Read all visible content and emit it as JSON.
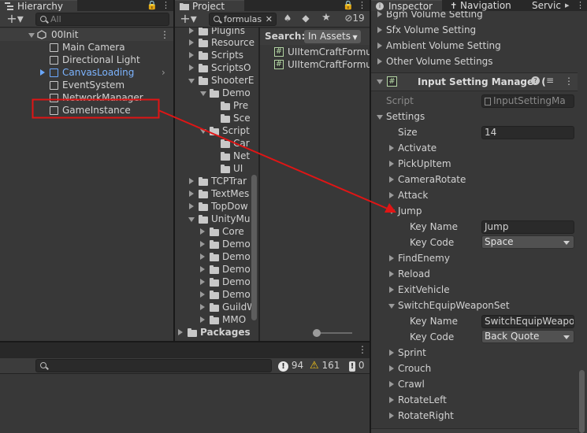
{
  "hierarchy": {
    "tab_label": "Hierarchy",
    "search_placeholder": "All",
    "scene_name": "00Init",
    "items": [
      {
        "label": "Main Camera"
      },
      {
        "label": "Directional Light"
      },
      {
        "label": "CanvasLoading",
        "color": "#7cb4ff"
      },
      {
        "label": "EventSystem"
      },
      {
        "label": "NetworkManager"
      },
      {
        "label": "GameInstance"
      }
    ]
  },
  "project": {
    "tab_label": "Project",
    "search_value": "formulas",
    "filter_count": "19",
    "search_label": "Search:",
    "search_scope": "In Assets",
    "tree": [
      {
        "label": "Plugins"
      },
      {
        "label": "Resource"
      },
      {
        "label": "Scripts"
      },
      {
        "label": "ScriptsO"
      },
      {
        "label": "ShooterE"
      },
      {
        "label": "Demo"
      },
      {
        "label": "Pre"
      },
      {
        "label": "Sce"
      },
      {
        "label": "Script"
      },
      {
        "label": "Car"
      },
      {
        "label": "Net"
      },
      {
        "label": "UI"
      },
      {
        "label": "TCPTrar"
      },
      {
        "label": "TextMes"
      },
      {
        "label": "TopDow"
      },
      {
        "label": "UnityMu"
      },
      {
        "label": "Core"
      },
      {
        "label": "Demo"
      },
      {
        "label": "Demo"
      },
      {
        "label": "Demo"
      },
      {
        "label": "Demo"
      },
      {
        "label": "Demo"
      },
      {
        "label": "GuildW"
      },
      {
        "label": "MMO"
      },
      {
        "label": "Packages"
      }
    ],
    "results": [
      {
        "label": "UIItemCraftFormula"
      },
      {
        "label": "UIItemCraftFormula"
      }
    ]
  },
  "console": {
    "error_count": "94",
    "warning_count": "161",
    "info_count": "0"
  },
  "inspector": {
    "tabs": [
      "Inspector",
      "Navigation",
      "Servic"
    ],
    "volume_items": [
      "Bgm Volume Setting",
      "Sfx Volume Setting",
      "Ambient Volume Setting",
      "Other Volume Settings"
    ],
    "component_title": "Input Setting Manager (",
    "script_label": "Script",
    "script_value": "InputSettingMa",
    "settings_label": "Settings",
    "size_label": "Size",
    "size_value": "14",
    "actions": [
      "Activate",
      "PickUpItem",
      "CameraRotate",
      "Attack",
      "Jump",
      "FindEnemy",
      "Reload",
      "ExitVehicle",
      "SwitchEquipWeaponSet",
      "Sprint",
      "Crouch",
      "Crawl",
      "RotateLeft",
      "RotateRight"
    ],
    "key_name_label": "Key Name",
    "key_code_label": "Key Code",
    "jump_key_name": "Jump",
    "jump_key_code": "Space",
    "switch_key_name": "SwitchEquipWeapon",
    "switch_key_code": "Back Quote"
  },
  "annotation": {
    "highlight_color": "#e01515"
  }
}
